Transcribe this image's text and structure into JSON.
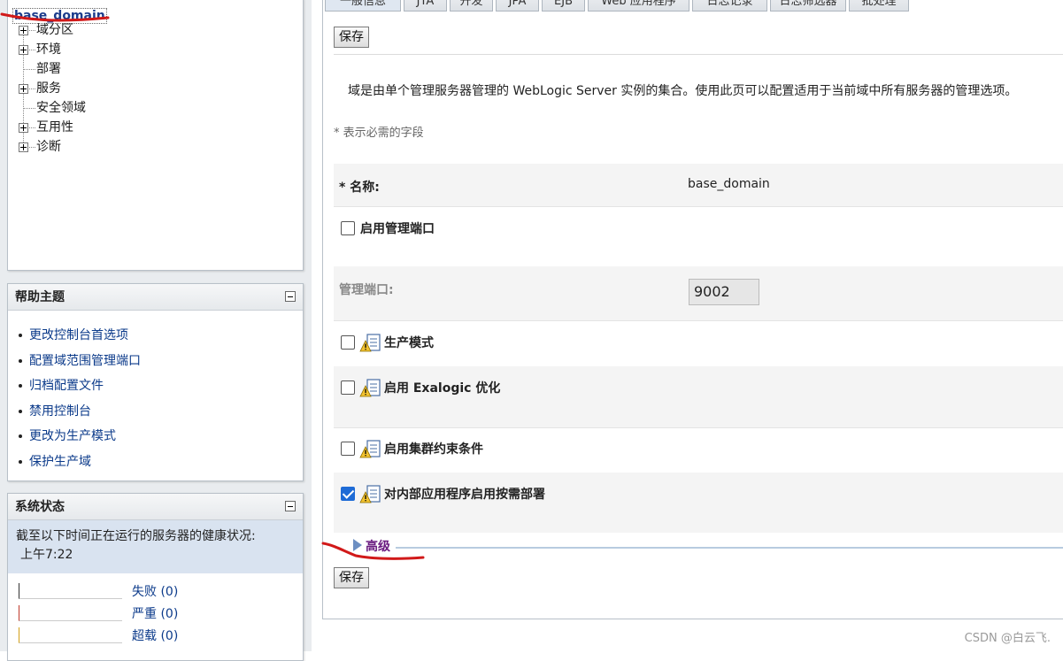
{
  "tree": {
    "root": "base_domain",
    "items": [
      {
        "label": "域分区",
        "expandable": true
      },
      {
        "label": "环境",
        "expandable": true
      },
      {
        "label": "部署",
        "expandable": false
      },
      {
        "label": "服务",
        "expandable": true
      },
      {
        "label": "安全领域",
        "expandable": false
      },
      {
        "label": "互用性",
        "expandable": true
      },
      {
        "label": "诊断",
        "expandable": true
      }
    ]
  },
  "help": {
    "title": "帮助主题",
    "links": [
      "更改控制台首选项",
      "配置域范围管理端口",
      "归档配置文件",
      "禁用控制台",
      "更改为生产模式",
      "保护生产域"
    ]
  },
  "system_status": {
    "title": "系统状态",
    "description": "截至以下时间正在运行的服务器的健康状况:",
    "time": "上午7:22",
    "rows": [
      {
        "label": "失败 (0)",
        "color": "#333333"
      },
      {
        "label": "严重 (0)",
        "color": "#c0392b"
      },
      {
        "label": "超载 (0)",
        "color": "#d4a017"
      }
    ]
  },
  "tabs": [
    "一般信息",
    "JTA",
    "开发",
    "JPA",
    "EJB",
    "Web 应用程序",
    "日志记录",
    "日志筛选器",
    "批处理"
  ],
  "form": {
    "save_label": "保存",
    "description": "域是由单个管理服务器管理的 WebLogic Server 实例的集合。使用此页可以配置适用于当前域中所有服务器的管理选项。",
    "required_note": "* 表示必需的字段",
    "name_label": "* 名称:",
    "name_value": "base_domain",
    "admin_port_enabled_label": "启用管理端口",
    "admin_port_label": "管理端口:",
    "admin_port_value": "9002",
    "production_mode_label": "生产模式",
    "exalogic_label": "启用 Exalogic 优化",
    "cluster_constraints_label": "启用集群约束条件",
    "on_demand_label": "对内部应用程序启用按需部署",
    "advanced_label": "高级",
    "checkboxes": {
      "admin_port_enabled": false,
      "production_mode": false,
      "exalogic": false,
      "cluster_constraints": false,
      "on_demand": true
    }
  },
  "watermark": "CSDN @白云飞."
}
